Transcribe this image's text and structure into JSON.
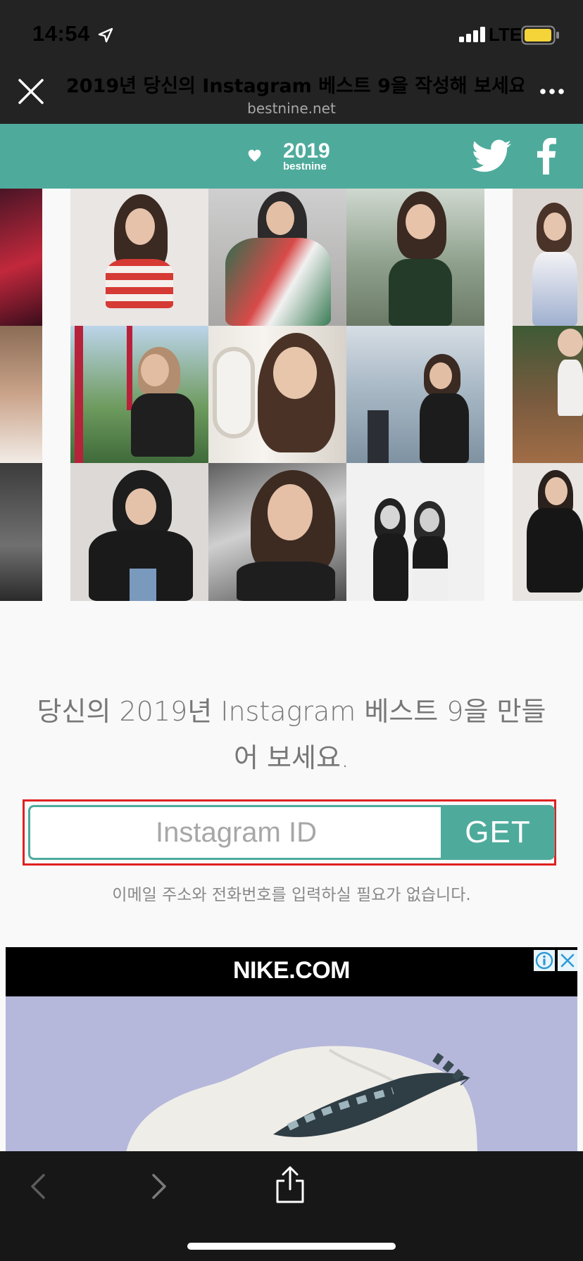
{
  "status": {
    "time": "14:54",
    "network": "LTE"
  },
  "browser": {
    "title": "2019년 당신의 Instagram 베스트 9을 작성해 보세요....",
    "domain": "bestnine.net"
  },
  "site": {
    "logo_year": "2019",
    "logo_sub": "bestnine",
    "accent_color": "#4eab9c"
  },
  "prompt": {
    "line1": "당신의 2019년 Instagram 베스트 9을 만들",
    "line2": "어 보세요."
  },
  "form": {
    "placeholder": "Instagram ID",
    "button": "GET",
    "hint": "이메일 주소와 전화번호를 입력하실 필요가 없습니다."
  },
  "ad": {
    "brand": "NIKE.COM"
  },
  "icons": {
    "close": "close-icon",
    "more": "more-icon",
    "twitter": "twitter-icon",
    "facebook": "facebook-icon",
    "back": "back-icon",
    "forward": "forward-icon",
    "share": "share-icon"
  }
}
